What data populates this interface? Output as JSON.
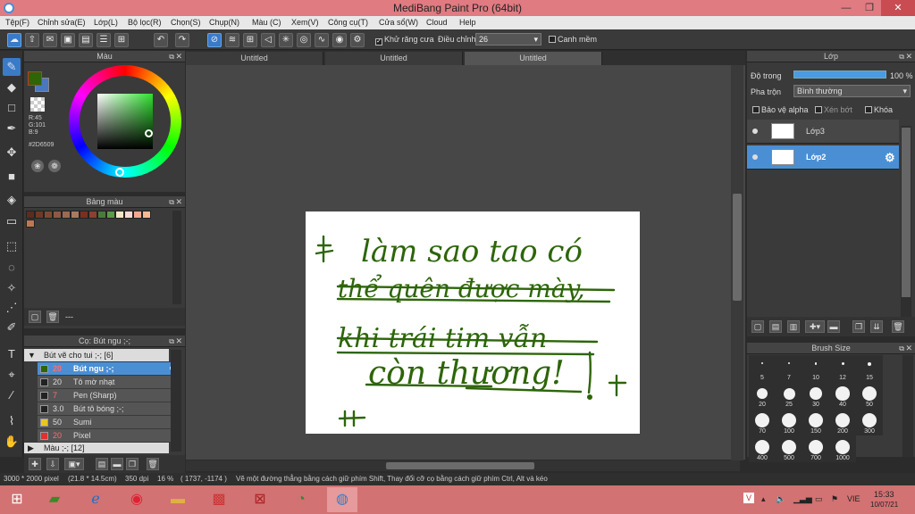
{
  "window": {
    "title": "MediBang Paint Pro (64bit)",
    "minimize": "—",
    "restore": "❐",
    "close": "✕"
  },
  "menu": [
    "Tệp(F)",
    "Chỉnh sửa(E)",
    "Lớp(L)",
    "Bộ lọc(R)",
    "Chọn(S)",
    "Chụp(N)",
    "Màu (C)",
    "Xem(V)",
    "Công cụ(T)",
    "Cửa sổ(W)",
    "Cloud",
    "Help"
  ],
  "toolbar": {
    "antialias_label": "Khử răng cưa",
    "antialias_checked": "✓",
    "size_label": "Điều chỉnh",
    "size_value": "26",
    "edge_label": "Canh mềm"
  },
  "color_panel": {
    "title": "Màu",
    "r": "R:45",
    "g": "G:101",
    "b": "B:9",
    "hex": "#2D6509"
  },
  "palette_panel": {
    "title": "Bảng màu",
    "footer": "---",
    "swatches": [
      "#5a2d1d",
      "#6d3a26",
      "#7c4a33",
      "#8b5a43",
      "#9a6a52",
      "#a87a62",
      "#7a3020",
      "#8b4030",
      "#4a7a3a",
      "#5c9a48",
      "#f4e6c4",
      "#f8d8d0",
      "#f2a890",
      "#f5b898"
    ],
    "swatch2": "#c07850"
  },
  "brush_panel": {
    "title": "Cọ: Bút ngu ;-;",
    "group": "Bút vẽ cho tui ;-; [6]",
    "group2": "Màu ;-; [12]",
    "brushes": [
      {
        "size": "20",
        "name": "Bút ngu ;-;",
        "color": "#2d6509"
      },
      {
        "size": "20",
        "name": "Tô mờ nhạt",
        "color": "#222222"
      },
      {
        "size": "7",
        "name": "Pen (Sharp)",
        "color": "#222222"
      },
      {
        "size": "3.0",
        "name": "Bút tô bóng ;-;",
        "color": "#222222"
      },
      {
        "size": "50",
        "name": "Sumi",
        "color": "#e8c820"
      },
      {
        "size": "20",
        "name": "Pixel",
        "color": "#e03030"
      }
    ]
  },
  "tabs": [
    "Untitled",
    "Untitled",
    "Untitled"
  ],
  "canvas": {
    "lines": [
      "làm sao tao có",
      "thể quên được mày,",
      "khi trái tim vẫn",
      "còn thương!"
    ],
    "ink": "#2d6509"
  },
  "layer_panel": {
    "title": "Lớp",
    "opacity_label": "Độ trong",
    "opacity_value": "100 %",
    "blend_label": "Pha trộn",
    "blend_value": "Bình thường",
    "alpha_label": "Bảo vệ alpha",
    "clip_label": "Xén bớt",
    "lock_label": "Khóa",
    "layers": [
      "Lớp3",
      "Lớp2"
    ]
  },
  "brush_size_panel": {
    "title": "Brush Size",
    "sizes": [
      "5",
      "7",
      "10",
      "12",
      "15",
      "20",
      "25",
      "30",
      "40",
      "50",
      "70",
      "100",
      "150",
      "200",
      "300",
      "400",
      "500",
      "700",
      "1000"
    ]
  },
  "status": {
    "dims": "3000 * 2000 pixel",
    "size_cm": "(21.8 * 14.5cm)",
    "dpi": "350 dpi",
    "zoom": "16 %",
    "coords": "( 1737, -1174 )",
    "hint": "Vẽ một đường thẳng bằng cách giữ phím Shift, Thay đổi cỡ cọ bằng cách giữ phím Ctrl, Alt và kéo"
  },
  "taskbar": {
    "lang": "VIE",
    "time": "15:33",
    "date": "10/07/21"
  }
}
